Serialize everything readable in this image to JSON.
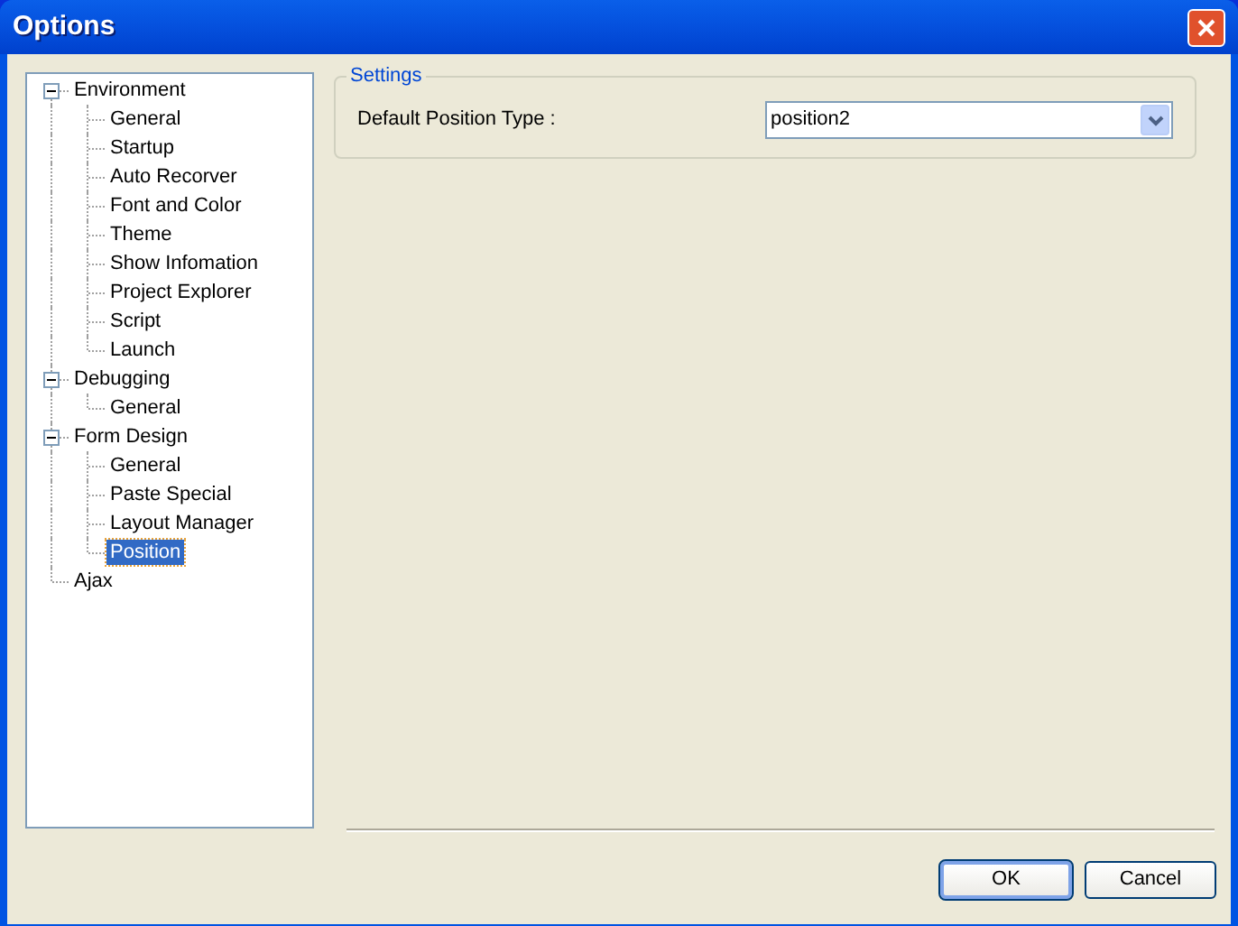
{
  "window": {
    "title": "Options"
  },
  "tree": [
    {
      "label": "Environment",
      "expanded": true,
      "selected": false,
      "children": [
        {
          "label": "General",
          "selected": false
        },
        {
          "label": "Startup",
          "selected": false
        },
        {
          "label": "Auto Recorver",
          "selected": false
        },
        {
          "label": "Font and Color",
          "selected": false
        },
        {
          "label": "Theme",
          "selected": false
        },
        {
          "label": "Show Infomation",
          "selected": false
        },
        {
          "label": "Project Explorer",
          "selected": false
        },
        {
          "label": "Script",
          "selected": false
        },
        {
          "label": "Launch",
          "selected": false
        }
      ]
    },
    {
      "label": "Debugging",
      "expanded": true,
      "selected": false,
      "children": [
        {
          "label": "General",
          "selected": false
        }
      ]
    },
    {
      "label": "Form Design",
      "expanded": true,
      "selected": false,
      "children": [
        {
          "label": "General",
          "selected": false
        },
        {
          "label": "Paste Special",
          "selected": false
        },
        {
          "label": "Layout Manager",
          "selected": false
        },
        {
          "label": "Position",
          "selected": true
        }
      ]
    },
    {
      "label": "Ajax",
      "selected": false
    }
  ],
  "settings": {
    "title": "Settings",
    "label": "Default Position Type :",
    "value": "position2"
  },
  "buttons": [
    "OK",
    "Cancel"
  ]
}
